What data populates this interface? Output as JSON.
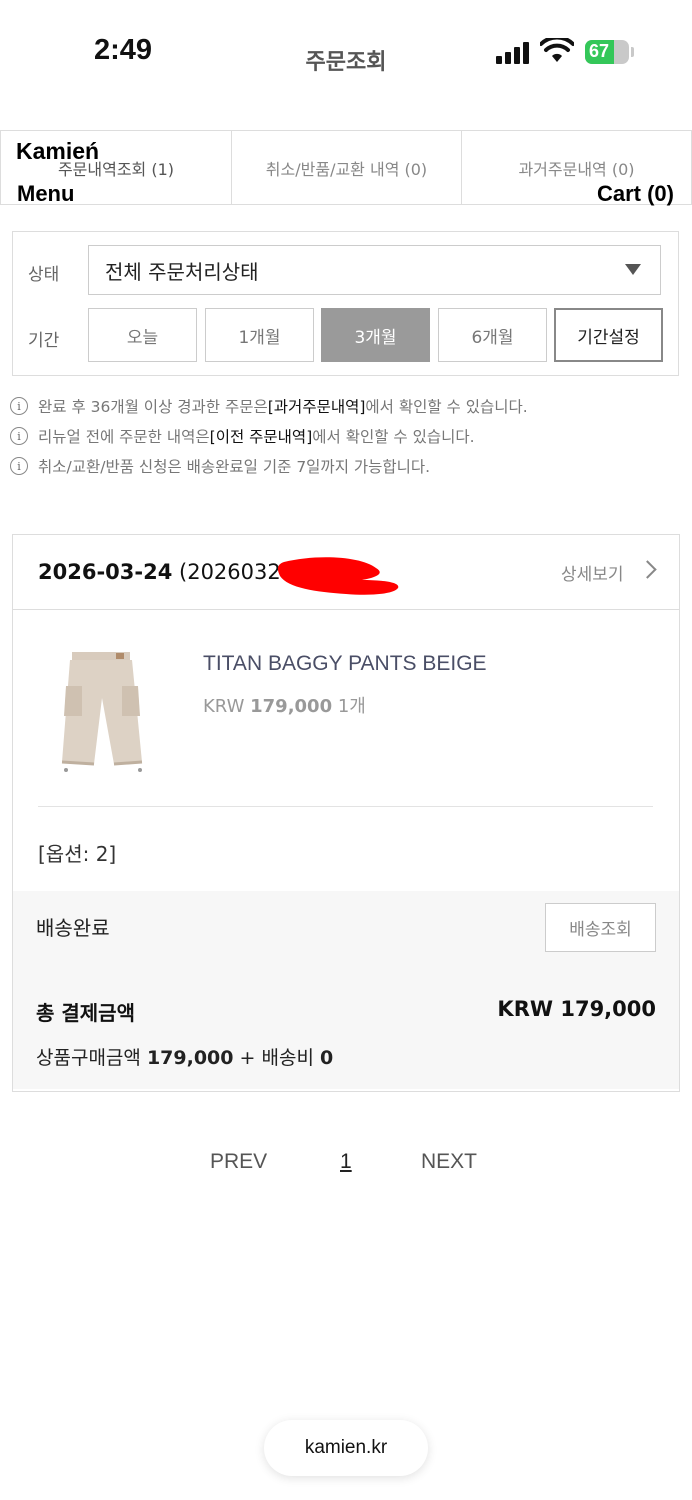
{
  "status_bar": {
    "time": "2:49",
    "battery": "67",
    "battery_level": 0.67
  },
  "page_title": "주문조회",
  "header": {
    "brand": "Kamień",
    "menu": "Menu",
    "cart": "Cart (0)"
  },
  "tabs": [
    {
      "label": "주문내역조회 (1)",
      "active": true
    },
    {
      "label": "취소/반품/교환 내역 (0)",
      "active": false
    },
    {
      "label": "과거주문내역 (0)",
      "active": false
    }
  ],
  "filter": {
    "status_label": "상태",
    "status_value": "전체 주문처리상태",
    "period_label": "기간",
    "periods": [
      {
        "label": "오늘",
        "active": false
      },
      {
        "label": "1개월",
        "active": false
      },
      {
        "label": "3개월",
        "active": true
      },
      {
        "label": "6개월",
        "active": false
      },
      {
        "label": "기간설정",
        "active": false
      }
    ]
  },
  "notes": [
    {
      "pre": "완료 후 36개월 이상 경과한 주문은 ",
      "strong": "[과거주문내역]",
      "post": "에서 확인할 수 있습니다."
    },
    {
      "pre": "리뉴얼 전에 주문한 내역은 ",
      "strong": "[이전 주문내역]",
      "post": "에서 확인할 수 있습니다."
    },
    {
      "pre": "취소/교환/반품 신청은 배송완료일 기준 7일까지 가능합니다.",
      "strong": "",
      "post": ""
    }
  ],
  "order": {
    "date": "2026-03-24",
    "number_visible": "(20260324-0",
    "detail_link": "상세보기",
    "product_name": "TITAN BAGGY PANTS BEIGE",
    "currency": "KRW",
    "price": "179,000",
    "quantity": "1개",
    "option": "[옵션: 2]",
    "shipping_status": "배송완료",
    "track_button": "배송조회",
    "total_label": "총 결제금액",
    "total_amount": "KRW 179,000",
    "breakdown_label": "상품구매금액",
    "breakdown_items": "179,000",
    "breakdown_plus": "+ 배송비",
    "breakdown_shipping": "0"
  },
  "pagination": {
    "prev": "PREV",
    "page": "1",
    "next": "NEXT"
  },
  "url": "kamien.kr",
  "colors": {
    "active_period_bg": "#9a9a9a",
    "battery_green": "#34c759",
    "redaction": "#ff0000"
  }
}
